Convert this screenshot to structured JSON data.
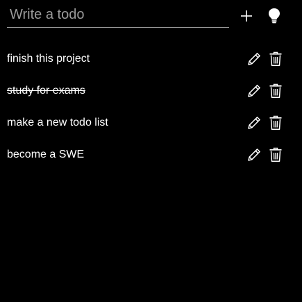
{
  "input": {
    "placeholder": "Write a todo",
    "value": ""
  },
  "actions": {
    "add_icon": "plus-icon",
    "idea_icon": "lightbulb-icon"
  },
  "todos": [
    {
      "text": "finish this project",
      "completed": false
    },
    {
      "text": "study for exams",
      "completed": true
    },
    {
      "text": "make a new todo list",
      "completed": false
    },
    {
      "text": "become a SWE",
      "completed": false
    }
  ],
  "colors": {
    "background": "#000000",
    "text": "#ffffff",
    "placeholder": "#9a9a9a",
    "underline": "#9a9a9a"
  }
}
